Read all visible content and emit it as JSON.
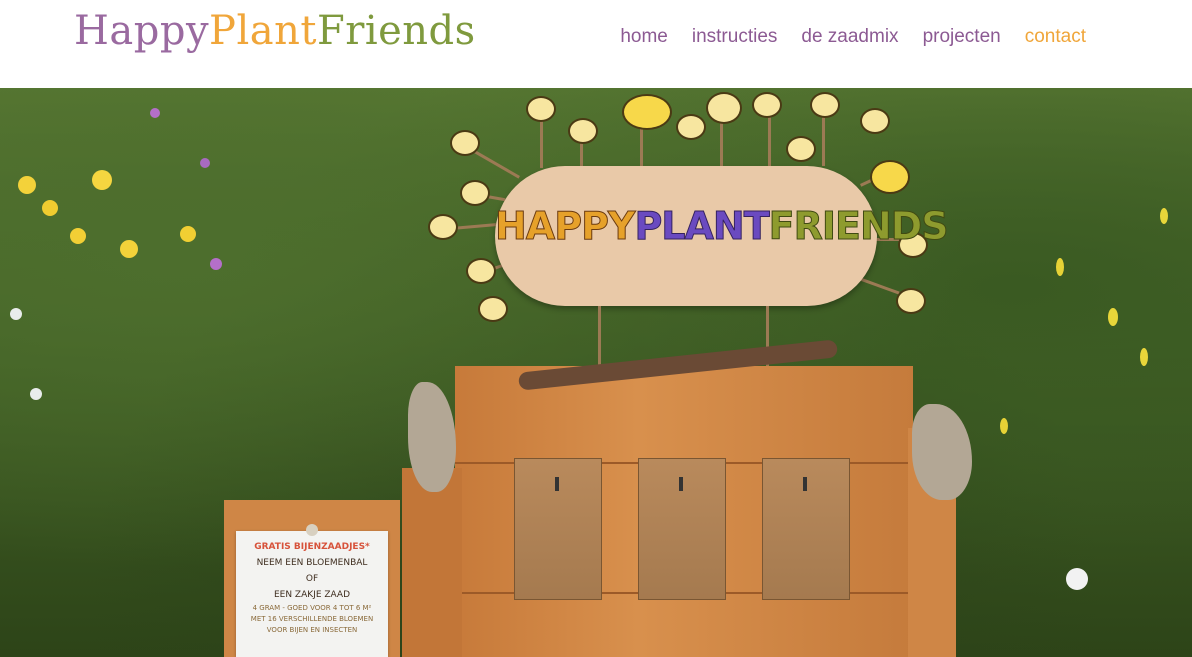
{
  "header": {
    "logo": {
      "happy": "Happy",
      "plant": "Plant",
      "friends": "Friends"
    },
    "nav": [
      {
        "label": "home",
        "active": false
      },
      {
        "label": "instructies",
        "active": false
      },
      {
        "label": "de zaadmix",
        "active": false
      },
      {
        "label": "projecten",
        "active": false
      },
      {
        "label": "contact",
        "active": true
      }
    ]
  },
  "hero": {
    "sign": {
      "happy": "HAPPY",
      "plant": "PLANT",
      "friends": "FRIENDS"
    },
    "card": {
      "line1": "GRATIS BIJENZAADJES*",
      "line2": "NEEM EEN BLOEMENBAL",
      "line3": "OF",
      "line4": "EEN ZAKJE ZAAD",
      "line5": "4 GRAM - GOED VOOR 4 TOT 6 M²",
      "line6": "MET 16 VERSCHILLENDE BLOEMEN",
      "line7": "VOOR BIJEN EN INSECTEN"
    }
  },
  "colors": {
    "logo_happy": "#9a6aa0",
    "logo_plant": "#f0a63a",
    "logo_friends": "#7f9a3e",
    "nav_default": "#8c5a93",
    "nav_active": "#f0a63a"
  }
}
